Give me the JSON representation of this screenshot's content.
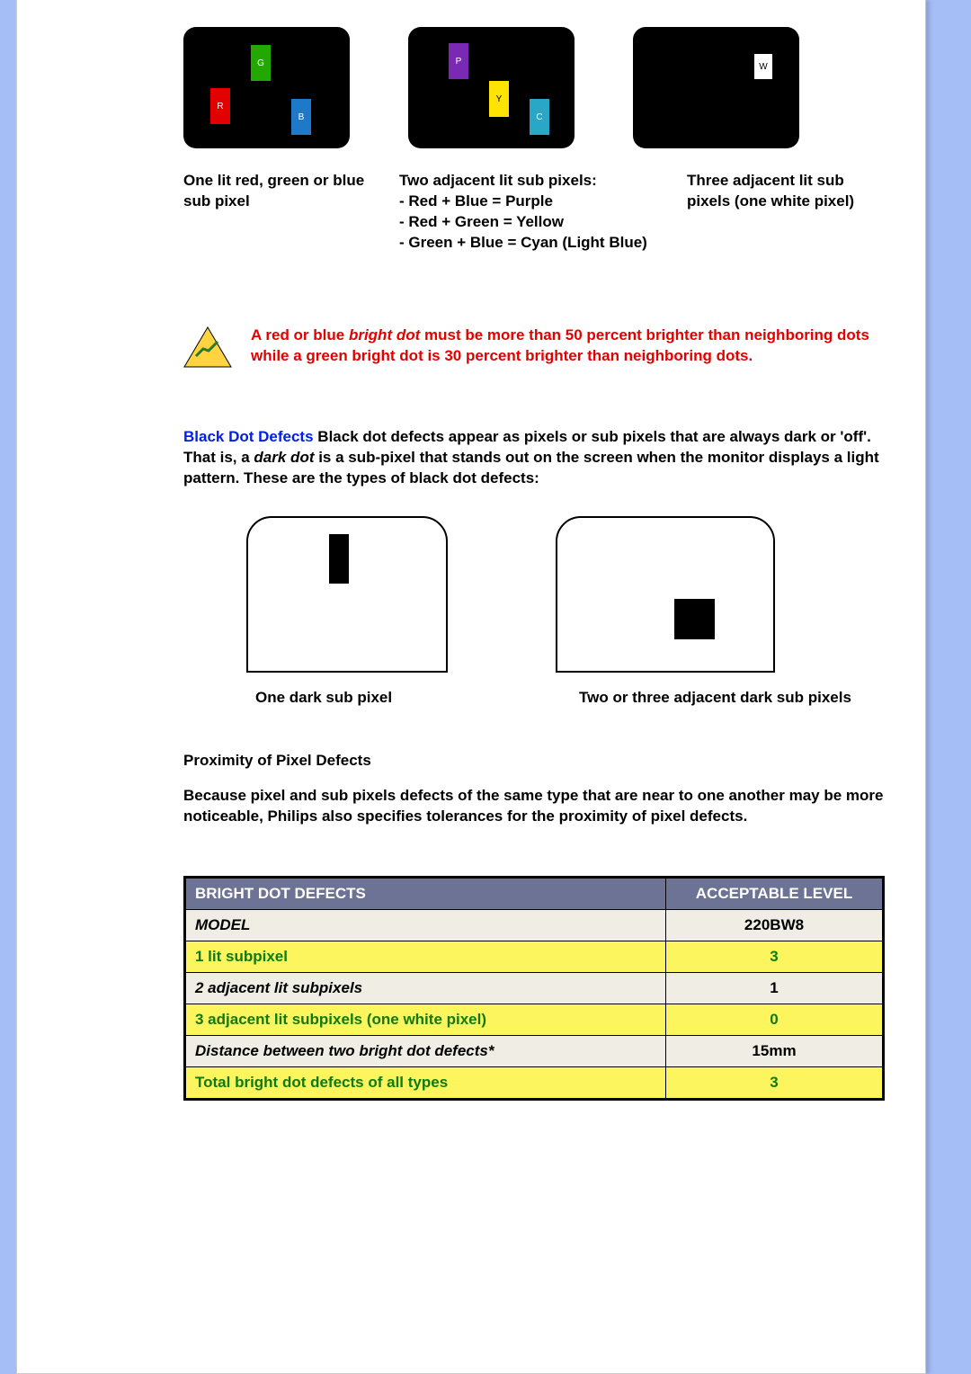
{
  "fig_labels": {
    "R": "R",
    "G": "G",
    "B": "B",
    "P": "P",
    "Y": "Y",
    "C": "C",
    "W": "W"
  },
  "captions": {
    "c1": "One lit red, green or blue sub pixel",
    "c2": "Two adjacent lit sub pixels:\n- Red + Blue = Purple\n- Red + Green = Yellow\n- Green + Blue = Cyan (Light Blue)",
    "c3": "Three adjacent lit sub pixels (one white pixel)"
  },
  "warning": {
    "pre": "A red or blue ",
    "em": "bright dot",
    "post": " must be more than 50 percent brighter than neighboring dots while a green bright dot is 30 percent brighter than neighboring dots."
  },
  "blackdot": {
    "title": "Black Dot Defects",
    "body": " Black dot defects appear as pixels or sub pixels that are always dark or 'off'. That is, a ",
    "em": "dark dot",
    "body2": " is a sub-pixel that stands out on the screen when the monitor displays a light pattern. These are the types of black dot defects:"
  },
  "dark_caps": {
    "d1": "One dark sub pixel",
    "d2": "Two or three adjacent dark sub pixels"
  },
  "prox_head": "Proximity of Pixel Defects",
  "prox_body": "Because pixel and sub pixels defects of the same type that are near to one another may be more noticeable, Philips also specifies tolerances for the proximity of pixel defects.",
  "table": {
    "h1": "BRIGHT DOT DEFECTS",
    "h2": "ACCEPTABLE LEVEL",
    "rows": [
      {
        "cls": "grey",
        "label": "MODEL",
        "val": "220BW8"
      },
      {
        "cls": "yel",
        "label": "1 lit subpixel",
        "val": "3"
      },
      {
        "cls": "grey",
        "label": "2 adjacent lit subpixels",
        "val": "1"
      },
      {
        "cls": "yel",
        "label": "3 adjacent lit subpixels (one white pixel)",
        "val": "0"
      },
      {
        "cls": "grey",
        "label": "Distance between two bright dot defects*",
        "val": "15mm"
      },
      {
        "cls": "yel",
        "label": "Total bright dot defects of all types",
        "val": "3"
      }
    ]
  }
}
